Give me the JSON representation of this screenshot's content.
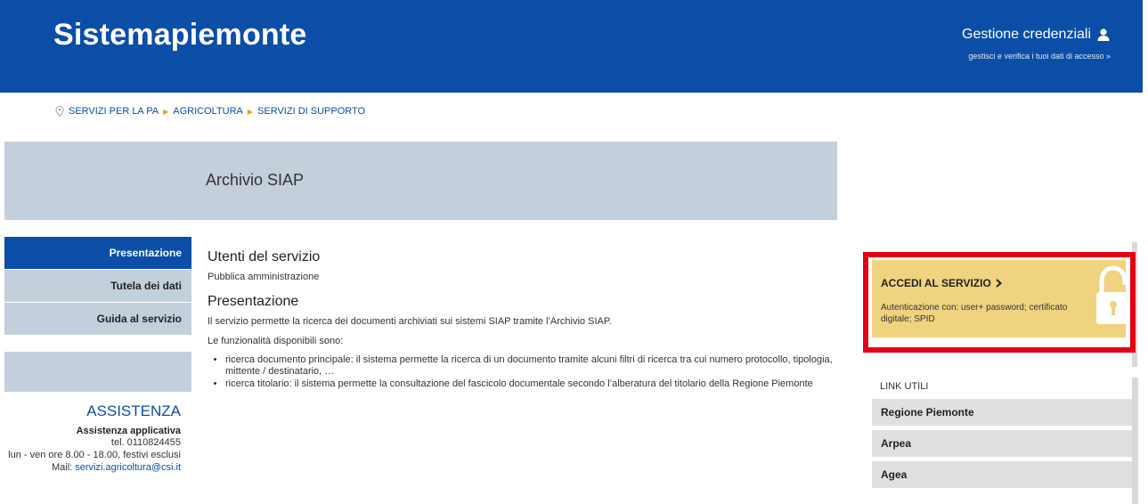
{
  "header": {
    "brand": "Sistemapiemonte",
    "credentials_title": "Gestione credenziali",
    "credentials_sub": "gestisci e verifica i tuoi dati di accesso »",
    "bg_color": "#0a4ea8"
  },
  "breadcrumb": {
    "items": [
      "SERVIZI PER LA PA",
      "AGRICOLTURA",
      "SERVIZI DI SUPPORTO"
    ]
  },
  "page": {
    "title": "Archivio SIAP"
  },
  "leftnav": {
    "items": [
      {
        "label": "Presentazione",
        "active": true
      },
      {
        "label": "Tutela dei dati",
        "active": false
      },
      {
        "label": "Guida al servizio",
        "active": false
      }
    ]
  },
  "assist": {
    "title": "ASSISTENZA",
    "subtitle": "Assistenza applicativa",
    "phone": "tel. 0110824455",
    "hours": "lun - ven ore 8.00 - 18.00, festivi esclusi",
    "mail_label": "Mail: ",
    "mail": "servizi.agricoltura@csi.it"
  },
  "main": {
    "users_heading": "Utenti del servizio",
    "users_text": "Pubblica amministrazione",
    "presentation_heading": "Presentazione",
    "presentation_text": "Il servizio permette la ricerca dei documenti archiviati sui sistemi SIAP tramite l’Archivio SIAP.",
    "features_intro": "Le funzionalità disponibili sono:",
    "features": [
      "ricerca documento principale: il sistema permette la ricerca di un documento tramite alcuni filtri di ricerca tra cui numero protocollo, tipologia, mittente / destinatario, …",
      "ricerca titolario: il sistema permette la consultazione del fascicolo documentale secondo l’alberatura del titolario della Regione Piemonte"
    ]
  },
  "access": {
    "title": "ACCEDI AL SERVIZIO",
    "text": "Autenticazione con: user+ password; certificato digitale; SPID",
    "highlight_color": "#e30016",
    "bg_color": "#f0d37f"
  },
  "links": {
    "title": "LINK UTILI",
    "items": [
      "Regione Piemonte",
      "Arpea",
      "Agea"
    ]
  }
}
